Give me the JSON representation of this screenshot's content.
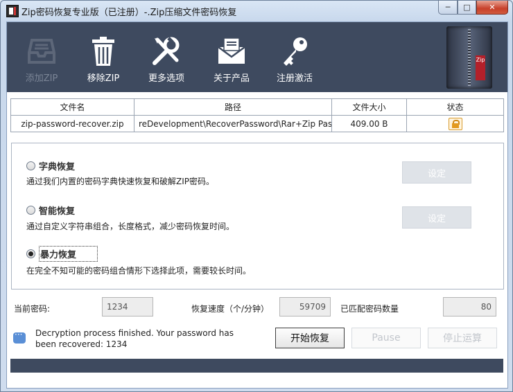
{
  "window": {
    "title": "Zip密码恢复专业版（已注册）-.Zip压缩文件密码恢复",
    "minimize": "─",
    "maximize": "□",
    "close": "✕"
  },
  "toolbar": {
    "items": [
      {
        "label": "添加ZIP",
        "icon": "tray-icon",
        "enabled": false
      },
      {
        "label": "移除ZIP",
        "icon": "trash-icon",
        "enabled": true
      },
      {
        "label": "更多选项",
        "icon": "tools-icon",
        "enabled": true
      },
      {
        "label": "关于产品",
        "icon": "envelope-icon",
        "enabled": true
      },
      {
        "label": "注册激活",
        "icon": "key-icon",
        "enabled": true
      }
    ],
    "art_tag": "Zip"
  },
  "file_table": {
    "headers": [
      "文件名",
      "路径",
      "文件大小",
      "状态"
    ],
    "rows": [
      {
        "name": "zip-password-recover.zip",
        "path": "reDevelopment\\RecoverPassword\\Rar+Zip Passwor",
        "size": "409.00 B",
        "status": "lock-icon"
      }
    ]
  },
  "options": [
    {
      "title": "字典恢复",
      "desc": "通过我们内置的密码字典快速恢复和破解ZIP密码。",
      "checked": false,
      "button": "设定"
    },
    {
      "title": "智能恢复",
      "desc": "通过自定义字符串组合，长度格式，减少密码恢复时间。",
      "checked": false,
      "button": "设定"
    },
    {
      "title": "暴力恢复",
      "desc": "在完全不知可能的密码组合情形下选择此项，需要较长时间。",
      "checked": true
    }
  ],
  "stats": {
    "current_password_label": "当前密码:",
    "current_password": "1234",
    "speed_label": "恢复速度（个/分钟）",
    "speed": "59709",
    "matched_label": "已匹配密码数量",
    "matched": "80"
  },
  "status_message": "Decryption process finished. Your password has been recovered: 1234",
  "actions": {
    "start": "开始恢复",
    "pause": "Pause",
    "stop": "停止运算"
  }
}
